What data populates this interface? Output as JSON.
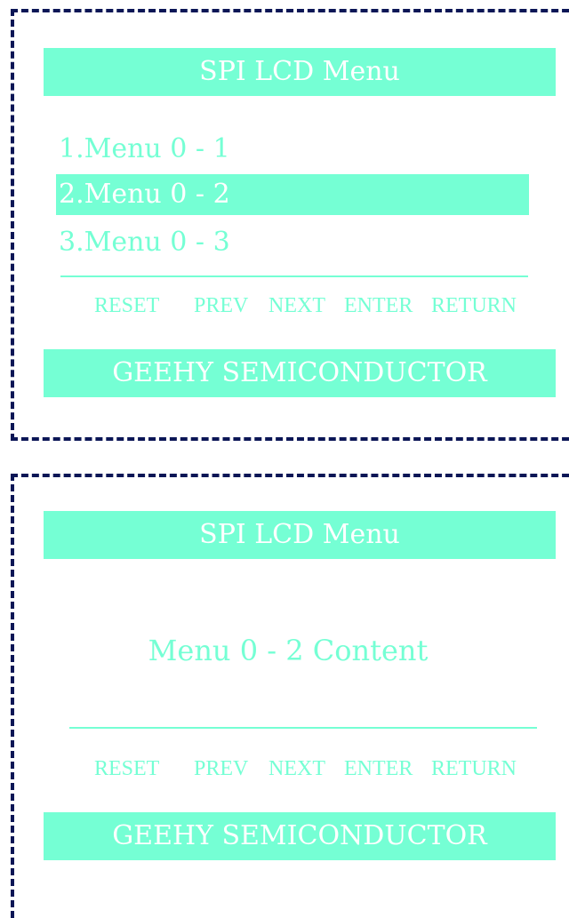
{
  "colors": {
    "accent": "#75ffd4",
    "border": "#0b1656",
    "background": "#ffffff",
    "bar_text": "#ffffff"
  },
  "screen_menu": {
    "title": "SPI LCD Menu",
    "items": [
      {
        "label": "1.Menu 0 - 1",
        "selected": false
      },
      {
        "label": "2.Menu 0 - 2",
        "selected": true
      },
      {
        "label": "3.Menu 0 - 3",
        "selected": false
      }
    ],
    "buttons": [
      "RESET",
      "PREV",
      "NEXT",
      "ENTER",
      "RETURN"
    ],
    "footer": "GEEHY SEMICONDUCTOR"
  },
  "screen_content": {
    "title": "SPI LCD Menu",
    "content": "Menu 0 - 2 Content",
    "buttons": [
      "RESET",
      "PREV",
      "NEXT",
      "ENTER",
      "RETURN"
    ],
    "footer": "GEEHY SEMICONDUCTOR"
  }
}
